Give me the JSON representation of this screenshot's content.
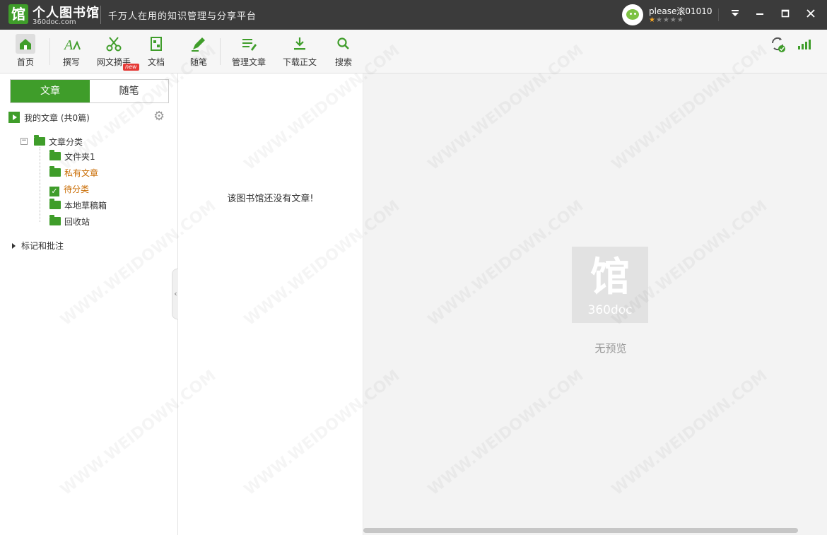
{
  "titlebar": {
    "logo_glyph": "馆",
    "app_name": "个人图书馆",
    "app_domain": "360doc.com",
    "slogan": "千万人在用的知识管理与分享平台",
    "username": "please滚01010",
    "stars": {
      "filled": 1,
      "total": 5
    }
  },
  "window_controls": [
    "menu-icon",
    "minimize-icon",
    "maximize-icon",
    "close-icon"
  ],
  "toolbar": {
    "items": [
      {
        "label": "首页",
        "icon": "home-icon"
      },
      {
        "label": "撰写",
        "icon": "write-icon"
      },
      {
        "label": "网文摘手",
        "icon": "scissors-icon",
        "badge": "new"
      },
      {
        "label": "文档",
        "icon": "document-icon"
      },
      {
        "label": "随笔",
        "icon": "pen-icon"
      },
      {
        "label": "管理文章",
        "icon": "manage-icon"
      },
      {
        "label": "下载正文",
        "icon": "download-icon"
      },
      {
        "label": "搜索",
        "icon": "search-icon"
      }
    ],
    "right_icons": [
      "sync-icon",
      "signal-icon"
    ]
  },
  "sidebar": {
    "tabs": [
      "文章",
      "随笔"
    ],
    "active_tab": "文章",
    "my_articles": "我的文章 (共0篇)",
    "tree_root": "文章分类",
    "tree_items": [
      "文件夹1",
      "私有文章",
      "待分类",
      "本地草稿箱",
      "回收站"
    ],
    "marks": "标记和批注"
  },
  "list": {
    "empty_message": "该图书馆还没有文章!"
  },
  "preview": {
    "logo_text": "360doc",
    "no_preview": "无预览"
  },
  "watermark": "WWW.WEIDOWN.COM",
  "colors": {
    "brand_green": "#3f9d2a",
    "titlebar": "#3b3b3b",
    "accent_orange": "#c96b00"
  }
}
